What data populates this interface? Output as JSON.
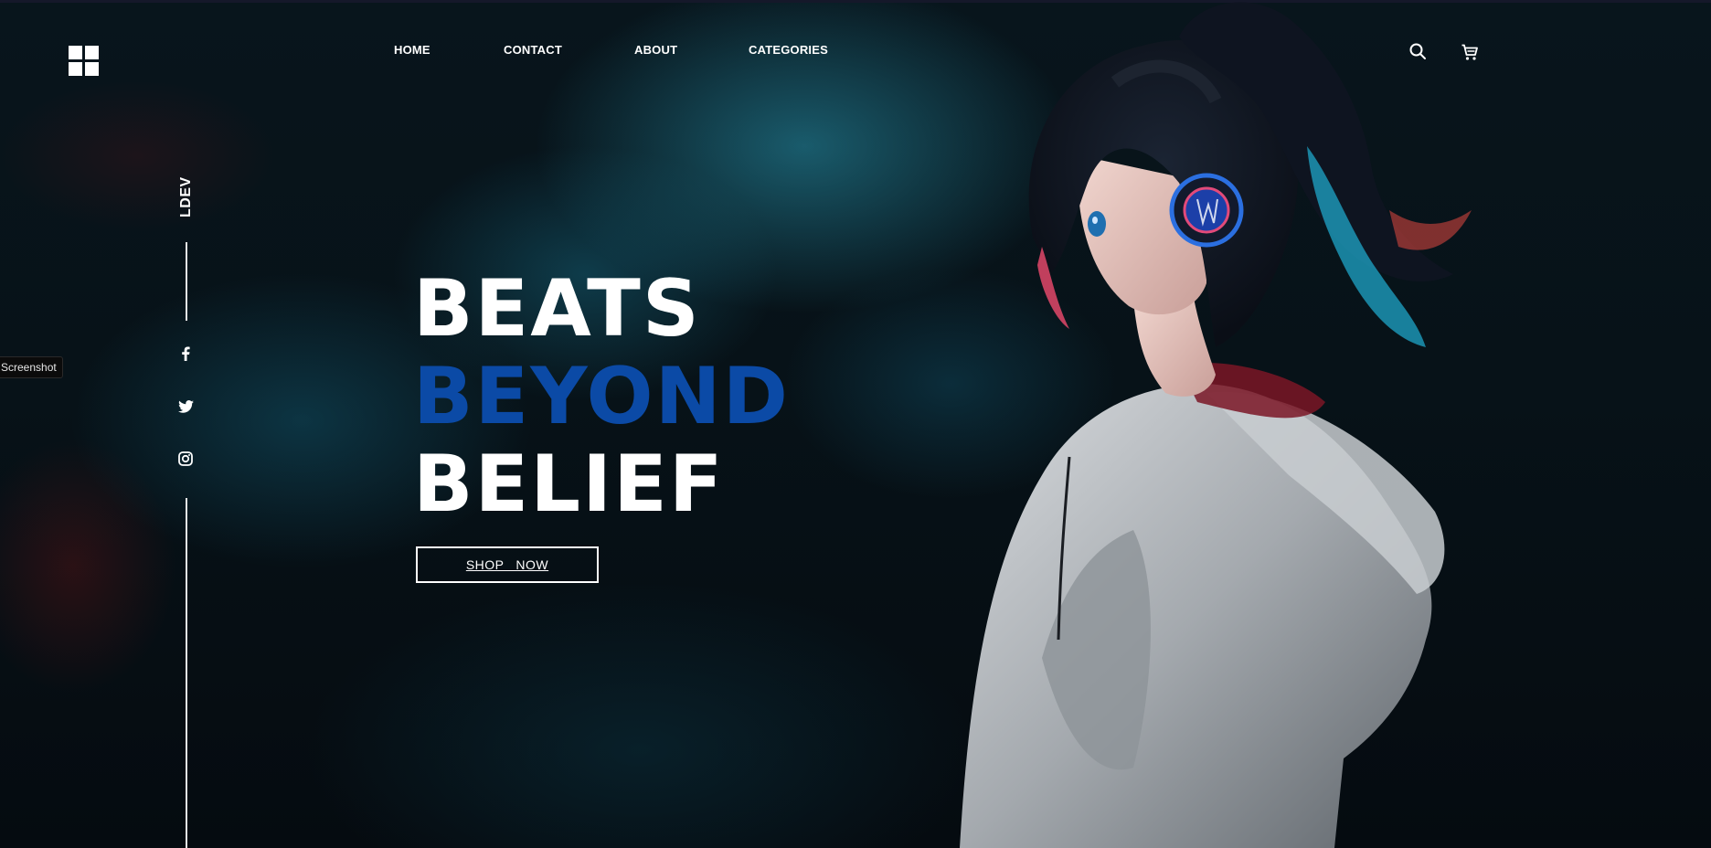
{
  "brand": {
    "logo_icon": "grid-logo-icon",
    "vertical_name": "LDEV"
  },
  "nav": {
    "items": [
      {
        "label": "HOME"
      },
      {
        "label": "CONTACT"
      },
      {
        "label": "ABOUT"
      },
      {
        "label": "CATEGORIES"
      }
    ],
    "search_icon": "search-icon",
    "cart_icon": "cart-icon"
  },
  "social": {
    "items": [
      {
        "icon": "facebook-icon"
      },
      {
        "icon": "twitter-icon"
      },
      {
        "icon": "instagram-icon"
      }
    ]
  },
  "tooltip": {
    "text": "Screenshot"
  },
  "hero": {
    "line1": "BEATS",
    "line2": "BEYOND",
    "line3": "BELIEF",
    "cta_label": "SHOP   NOW"
  },
  "colors": {
    "accent_blue": "#0b4aa6",
    "text": "#ffffff",
    "background": "#071218"
  }
}
